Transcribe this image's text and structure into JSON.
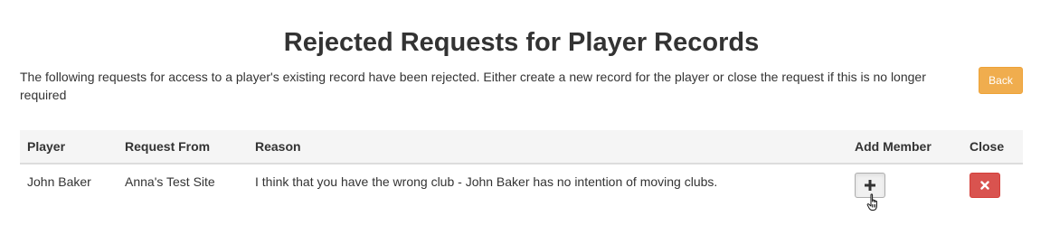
{
  "page": {
    "title": "Rejected Requests for Player Records",
    "intro": "The following requests for access to a player's existing record have been rejected. Either create a new record for the player or close the request if this is no longer required",
    "back_label": "Back"
  },
  "colors": {
    "back_button": "#f0ad4e",
    "close_button": "#d9534f",
    "header_bg": "#f5f5f5"
  },
  "table": {
    "headers": {
      "player": "Player",
      "request_from": "Request From",
      "reason": "Reason",
      "add_member": "Add Member",
      "close": "Close"
    },
    "rows": [
      {
        "player": "John Baker",
        "request_from": "Anna's Test Site",
        "reason": "I think that you have the wrong club - John Baker has no intention of moving clubs.",
        "add_icon": "plus-icon",
        "close_icon": "close-x-icon"
      }
    ]
  }
}
